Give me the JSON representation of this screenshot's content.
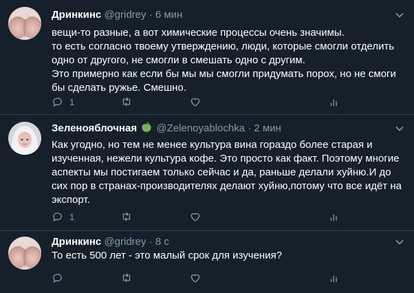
{
  "tweets": [
    {
      "name": "Дринкинс",
      "handle": "@gridrey",
      "sep": "·",
      "time": "6 мин",
      "text": "вещи-то разные, а вот химические процессы очень значимы.\nто есть согласно твоему утверждению, люди, которые смогли отделить одно от другого, не смогли в смешать одно с другим.\nЭто примерно как если бы мы мы смогли придумать порох, но не смоги бы сделать ружье. Смешно.",
      "reply_count": "1"
    },
    {
      "name": "Зеленояблочная",
      "handle": "@Zelenoyablochka",
      "sep": "·",
      "time": "2 мин",
      "text": "Как угодно, но тем не менее культура вина гораздо более старая и изученная, нежели культура кофе. Это просто как факт. Поэтому многие аспекты мы постигаем только сейчас и да, раньше делали хуйню.И до сих пор в странах-производителях делают хуйню,потому что все идёт на экспорт.",
      "reply_count": "1"
    },
    {
      "name": "Дринкинс",
      "handle": "@gridrey",
      "sep": "·",
      "time": "8 с",
      "text": "То есть 500 лет - это малый срок для изучения?",
      "reply_count": ""
    }
  ],
  "icons": {
    "reply": "reply-icon",
    "retweet": "retweet-icon",
    "like": "like-icon",
    "analytics": "analytics-icon",
    "caret": "chevron-down-icon",
    "emoji": "green-apple-emoji"
  },
  "colors": {
    "background": "#15202b",
    "secondary_text": "#8899a6",
    "divider": "#38444d"
  }
}
